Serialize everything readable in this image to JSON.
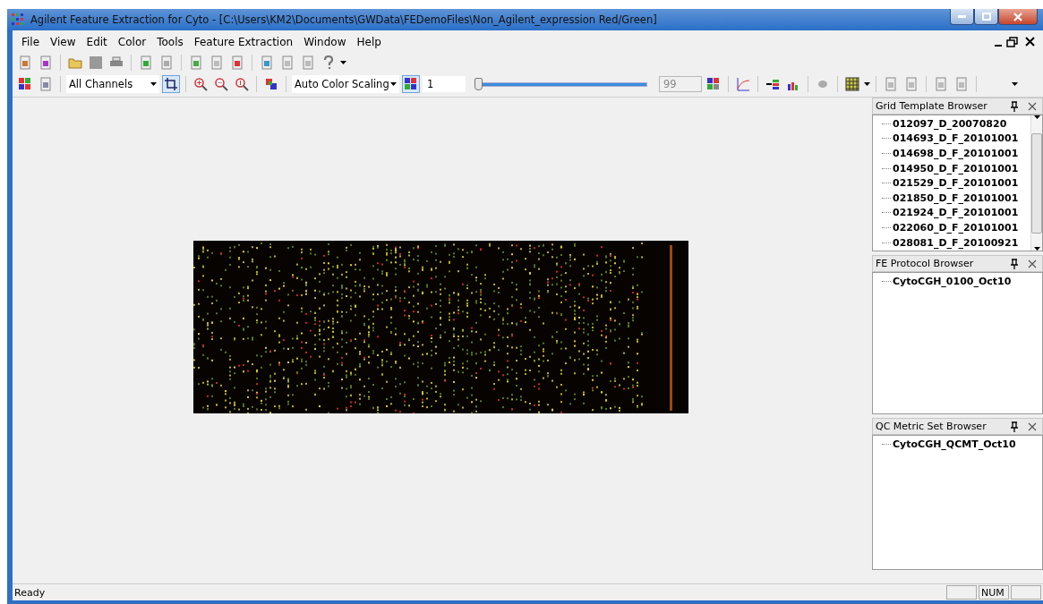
{
  "window": {
    "title": "Agilent Feature Extraction for Cyto - [C:\\Users\\KM2\\Documents\\GWData\\FEDemoFiles\\Non_Agilent_expression Red/Green]"
  },
  "menu": [
    "File",
    "View",
    "Edit",
    "Color",
    "Tools",
    "Feature Extraction",
    "Window",
    "Help"
  ],
  "toolbar": {
    "channel_select": {
      "value": "All Channels"
    },
    "crop_tool": {
      "pressed": true
    },
    "color_scaling_select": {
      "value": "Auto Color Scaling"
    },
    "color_map_button": {
      "pressed": true
    },
    "low_value": {
      "value": "1"
    },
    "range_slider": {
      "level": 0
    },
    "high_value": {
      "value": "99",
      "disabled": true
    }
  },
  "panels": [
    {
      "title": "Grid Template Browser",
      "scrollbar": true,
      "items": [
        "012097_D_20070820",
        "014693_D_F_20101001",
        "014698_D_F_20101001",
        "014950_D_F_20101001",
        "021529_D_F_20101001",
        "021850_D_F_20101001",
        "021924_D_F_20101001",
        "022060_D_F_20101001",
        "028081_D_F_20100921"
      ]
    },
    {
      "title": "FE Protocol Browser",
      "scrollbar": false,
      "items": [
        "CytoCGH_0100_Oct10"
      ]
    },
    {
      "title": "QC Metric Set Browser",
      "scrollbar": false,
      "items": [
        "CytoCGH_QCMT_Oct10"
      ]
    }
  ],
  "status_bar": {
    "message": "Ready",
    "indicators": [
      {
        "kind": "blank"
      },
      {
        "kind": "text",
        "text": "NUM"
      },
      {
        "kind": "blank"
      }
    ]
  }
}
